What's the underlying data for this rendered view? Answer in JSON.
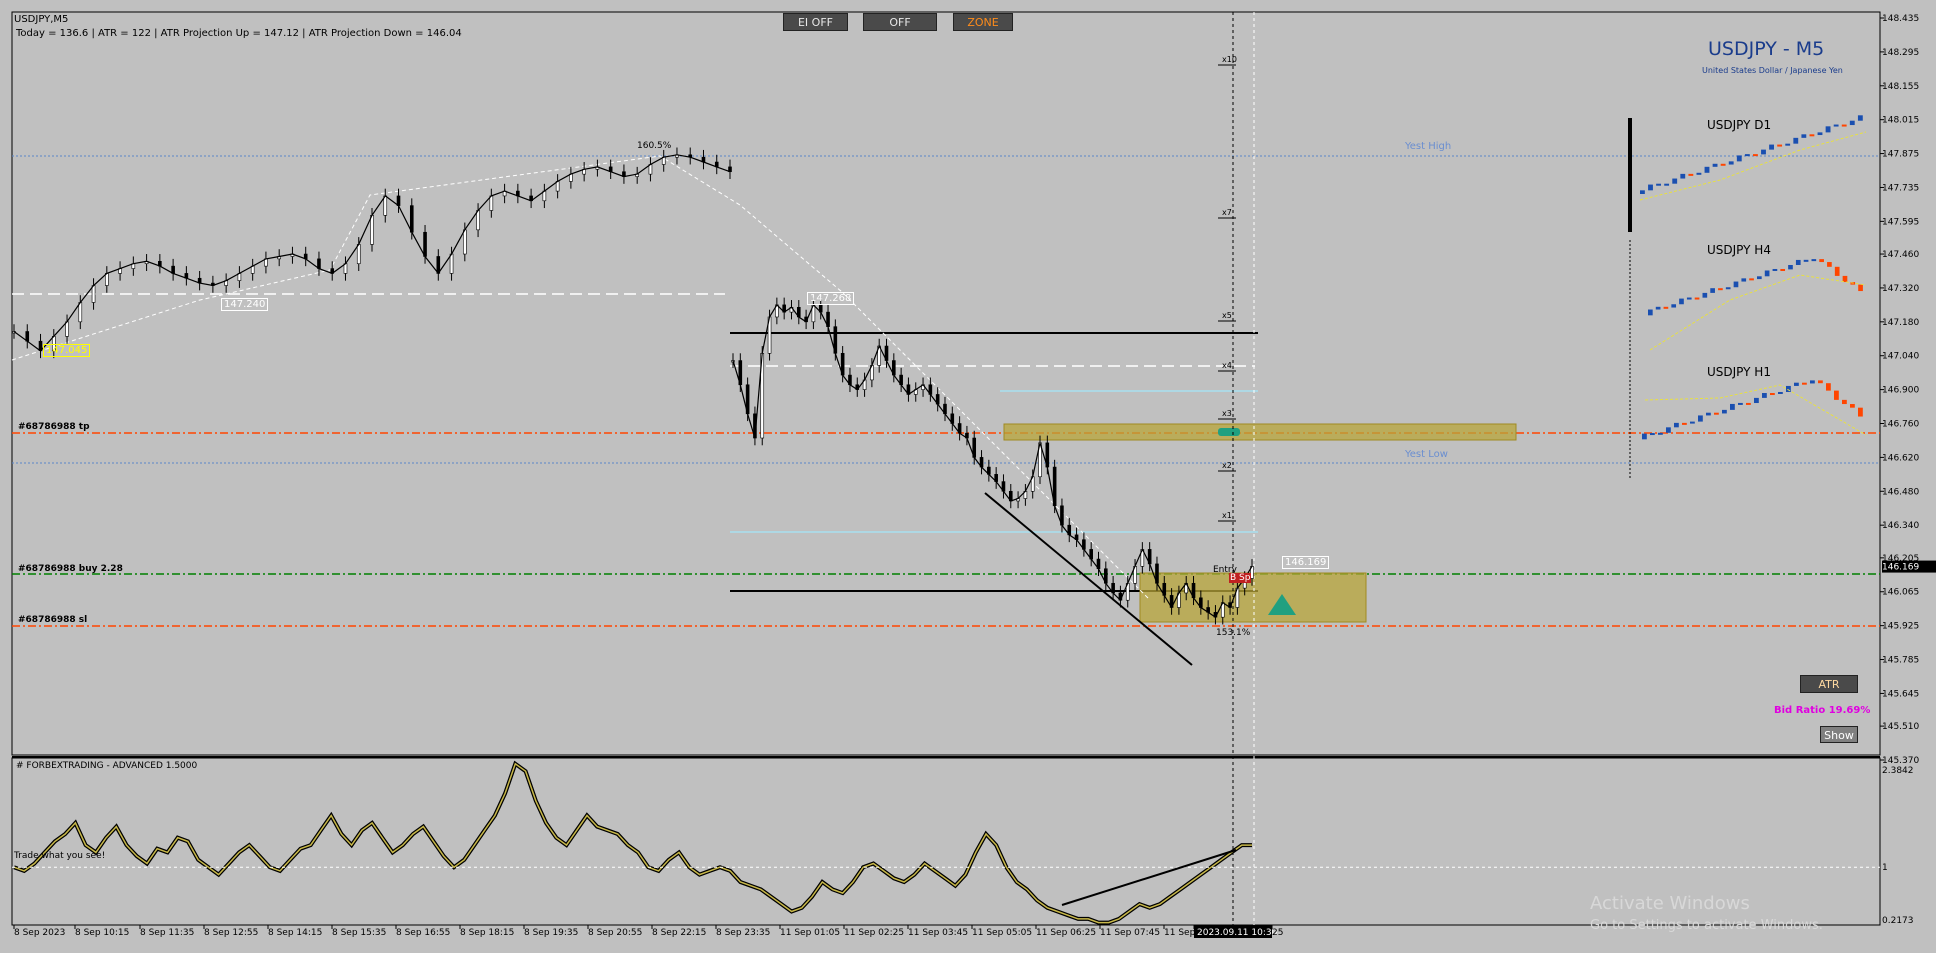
{
  "header": {
    "symbol": "USDJPY,M5",
    "stats": "Today = 136.6   |   ATR = 122   |   ATR Projection Up = 147.12   |   ATR Projection Down = 146.04"
  },
  "buttons": {
    "ei_off": "EI OFF",
    "off": "OFF",
    "zone": "ZONE",
    "atr": "ATR",
    "show": "Show"
  },
  "info": {
    "title": "USDJPY - M5",
    "subtitle": "United States Dollar / Japanese Yen",
    "d1": "USDJPY D1",
    "h4": "USDJPY H4",
    "h1": "USDJPY H1",
    "bid_ratio": "Bid Ratio 19.69%"
  },
  "levels": {
    "yest_high": "Yest High",
    "yest_low": "Yest Low",
    "tp": "#68786988 tp",
    "buy": "#68786988 buy 2.28",
    "sl": "#68786988 sl",
    "fib_top": "160.5%",
    "fib_bottom": "153.1%",
    "tag_147240": "147.240",
    "tag_147045": "147.045",
    "tag_147268": "147.268",
    "tag_146169": "146.169",
    "entry": "Entry",
    "sp": "B  Sp"
  },
  "grid_marks": [
    "x10",
    "x7",
    "x5",
    "x4",
    "x3",
    "x2",
    "x1"
  ],
  "indicator": {
    "title": "# FORBEXTRADING - ADVANCED 1.5000",
    "watermark": "Trade what you see!",
    "scale": [
      "2.3842",
      "1",
      "0.2173"
    ]
  },
  "watermark": {
    "line1": "Activate Windows",
    "line2": "Go to Settings to activate Windows."
  },
  "chart_data": {
    "type": "line",
    "title": "USDJPY - M5",
    "current_price": "146.169",
    "y_ticks": [
      "148.435",
      "148.295",
      "148.155",
      "148.015",
      "147.875",
      "147.735",
      "147.595",
      "147.460",
      "147.320",
      "147.180",
      "147.040",
      "146.900",
      "146.760",
      "146.620",
      "146.480",
      "146.340",
      "146.205",
      "146.065",
      "145.925",
      "145.785",
      "145.645",
      "145.510",
      "145.370"
    ],
    "x_ticks": [
      "8 Sep 2023",
      "8 Sep 10:15",
      "8 Sep 11:35",
      "8 Sep 12:55",
      "8 Sep 14:15",
      "8 Sep 15:35",
      "8 Sep 16:55",
      "8 Sep 18:15",
      "8 Sep 19:35",
      "8 Sep 20:55",
      "8 Sep 22:15",
      "8 Sep 23:35",
      "11 Sep 01:05",
      "11 Sep 02:25",
      "11 Sep 03:45",
      "11 Sep 05:05",
      "11 Sep 06:25",
      "11 Sep 07:45",
      "11 Sep",
      "2023.09.11 10:30",
      "25"
    ],
    "ylim": [
      145.37,
      148.47
    ],
    "series": [
      {
        "values": [
          147.14,
          147.1,
          147.06,
          147.12,
          147.18,
          147.26,
          147.33,
          147.38,
          147.4,
          147.42,
          147.43,
          147.41,
          147.38,
          147.36,
          147.34,
          147.33,
          147.35,
          147.38,
          147.41,
          147.44,
          147.45,
          147.46,
          147.44,
          147.4,
          147.38,
          147.42,
          147.5,
          147.62,
          147.7,
          147.66,
          147.55,
          147.45,
          147.38,
          147.46,
          147.56,
          147.64,
          147.7,
          147.72,
          147.7,
          147.68,
          147.72,
          147.76,
          147.79,
          147.81,
          147.82,
          147.8,
          147.78,
          147.79,
          147.83,
          147.86,
          147.87,
          147.86,
          147.84,
          147.82,
          147.8,
          147.02,
          146.92,
          146.8,
          146.7,
          147.05,
          147.2,
          147.25,
          147.22,
          147.24,
          147.2,
          147.18,
          147.25,
          147.22,
          147.16,
          147.05,
          146.96,
          146.92,
          146.9,
          146.94,
          147.0,
          147.08,
          147.02,
          146.96,
          146.92,
          146.88,
          146.9,
          146.92,
          146.88,
          146.84,
          146.8,
          146.76,
          146.72,
          146.7,
          146.62,
          146.58,
          146.55,
          146.52,
          146.48,
          146.44,
          146.45,
          146.48,
          146.54,
          146.68,
          146.58,
          146.42,
          146.34,
          146.3,
          146.28,
          146.24,
          146.2,
          146.16,
          146.1,
          146.06,
          146.03,
          146.1,
          146.17,
          146.24,
          146.18,
          146.1,
          146.05,
          146.0,
          146.06,
          146.1,
          146.04,
          146.0,
          145.98,
          145.96,
          146.02,
          146.0,
          146.08,
          146.12,
          146.17
        ]
      }
    ],
    "indicator_values": [
      1.0,
      0.95,
      1.05,
      1.2,
      1.35,
      1.45,
      1.6,
      1.3,
      1.2,
      1.4,
      1.55,
      1.3,
      1.15,
      1.05,
      1.25,
      1.2,
      1.4,
      1.35,
      1.1,
      1.0,
      0.9,
      1.05,
      1.2,
      1.3,
      1.15,
      1.0,
      0.95,
      1.1,
      1.25,
      1.3,
      1.5,
      1.7,
      1.45,
      1.3,
      1.5,
      1.6,
      1.4,
      1.2,
      1.3,
      1.45,
      1.55,
      1.35,
      1.15,
      1.0,
      1.1,
      1.3,
      1.5,
      1.7,
      2.0,
      2.4,
      2.3,
      1.9,
      1.6,
      1.4,
      1.3,
      1.5,
      1.7,
      1.55,
      1.5,
      1.45,
      1.3,
      1.2,
      1.0,
      0.95,
      1.1,
      1.2,
      1.0,
      0.9,
      0.95,
      1.0,
      0.95,
      0.8,
      0.75,
      0.7,
      0.6,
      0.5,
      0.4,
      0.45,
      0.6,
      0.8,
      0.7,
      0.65,
      0.8,
      1.0,
      1.05,
      0.95,
      0.85,
      0.8,
      0.9,
      1.05,
      0.95,
      0.85,
      0.75,
      0.9,
      1.2,
      1.45,
      1.3,
      1.0,
      0.8,
      0.7,
      0.55,
      0.45,
      0.4,
      0.35,
      0.3,
      0.3,
      0.25,
      0.25,
      0.3,
      0.4,
      0.5,
      0.45,
      0.5,
      0.6,
      0.7,
      0.8,
      0.9,
      1.0,
      1.1,
      1.2,
      1.3,
      1.3
    ]
  }
}
